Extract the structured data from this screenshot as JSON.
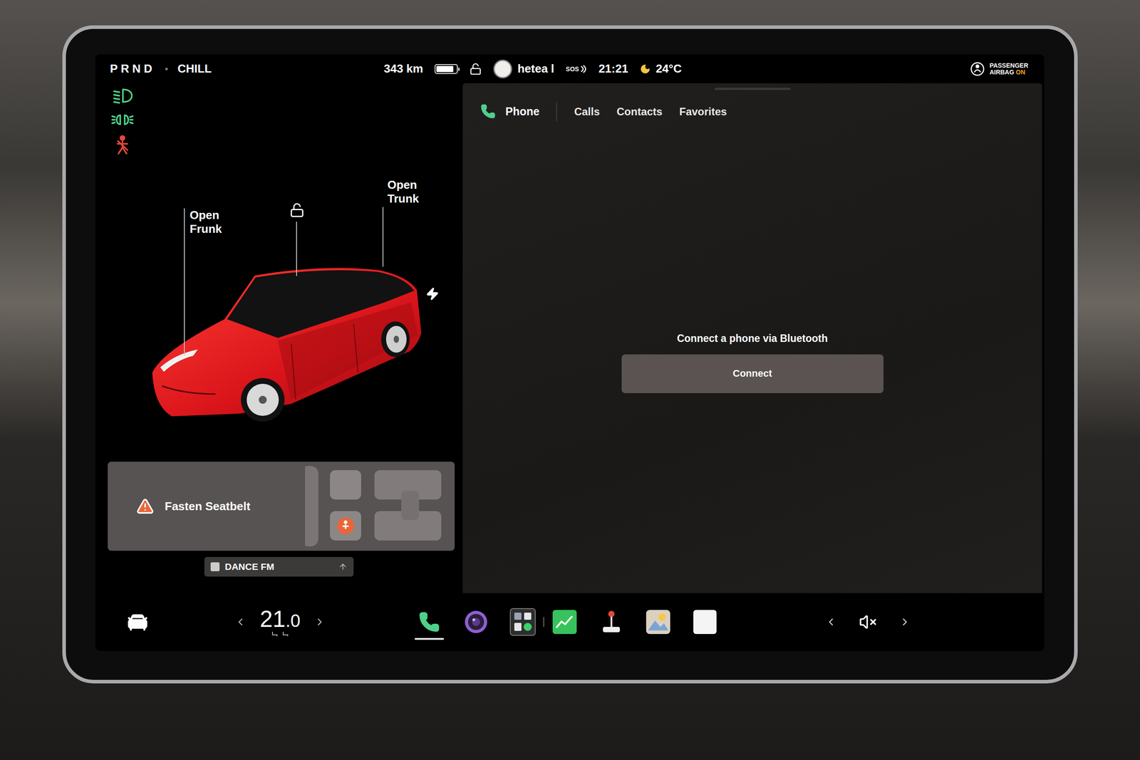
{
  "status_bar": {
    "gears": "PRND",
    "drive_mode": "CHILL",
    "range": "343 km",
    "battery_level": 0.85,
    "locked": false,
    "profile": "hetea l",
    "sos": "SOS",
    "time": "21:21",
    "temperature": "24°C",
    "airbag": {
      "line1": "PASSENGER",
      "line2": "AIRBAG",
      "state": "ON"
    }
  },
  "indicators": [
    {
      "kind": "low-beam",
      "color": "#4fd08a"
    },
    {
      "kind": "parking-lights",
      "color": "#4fd08a"
    },
    {
      "kind": "seatbelt",
      "color": "#e5483d"
    }
  ],
  "car": {
    "frunk": "Open Frunk",
    "trunk": "Open Trunk",
    "locked": false
  },
  "alert": {
    "text": "Fasten Seatbelt"
  },
  "radio": {
    "station": "DANCE FM"
  },
  "phone": {
    "title": "Phone",
    "tabs": [
      {
        "label": "Calls",
        "selected": false
      },
      {
        "label": "Contacts",
        "selected": false
      },
      {
        "label": "Favorites",
        "selected": false
      }
    ],
    "message": "Connect a phone via Bluetooth",
    "button": "Connect"
  },
  "dock": {
    "temperature": "21",
    "temperature_decimal": ".0",
    "muted": true,
    "apps": [
      {
        "kind": "phone",
        "selected": true
      },
      {
        "kind": "camera",
        "selected": false
      },
      {
        "kind": "launcher",
        "selected": false
      },
      {
        "kind": "chart",
        "selected": false
      },
      {
        "kind": "joystick",
        "selected": false
      },
      {
        "kind": "photos",
        "selected": false
      },
      {
        "kind": "notes",
        "selected": false
      }
    ]
  }
}
